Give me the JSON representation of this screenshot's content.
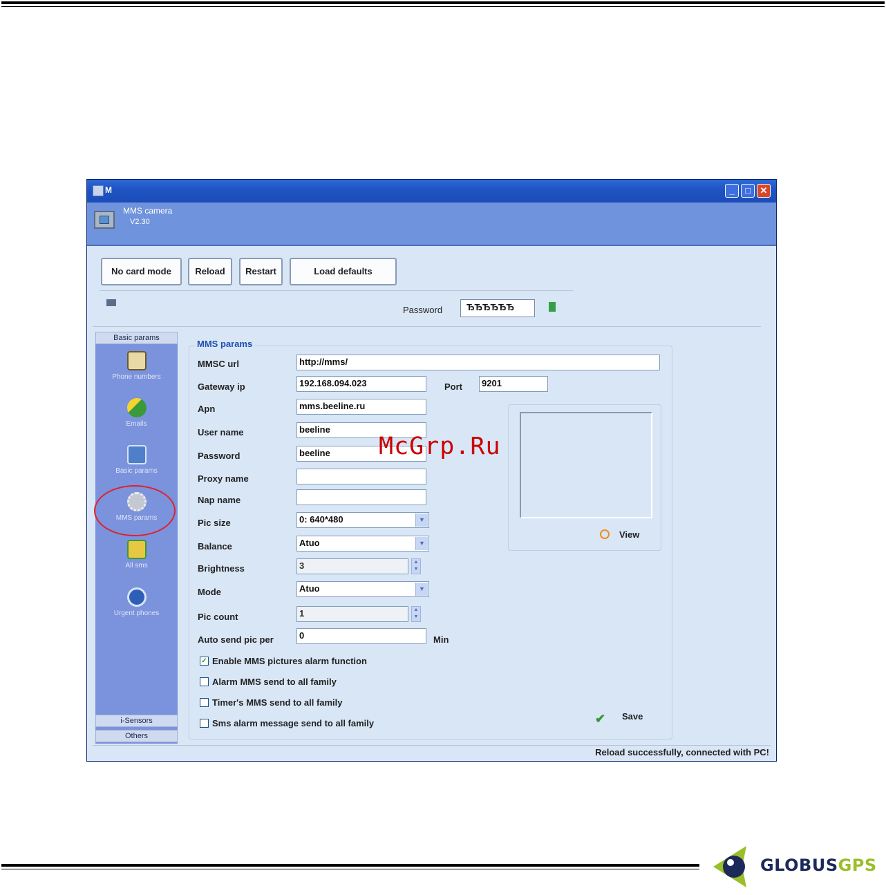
{
  "window": {
    "title": "M"
  },
  "header": {
    "app_name": "MMS camera",
    "version": "V2.30"
  },
  "toolbar": {
    "no_card_mode": "No card mode",
    "reload": "Reload",
    "restart": "Restart",
    "load_defaults": "Load defaults"
  },
  "password": {
    "label": "Password",
    "value": "ЂЂЂЂЂЂ"
  },
  "sidebar": {
    "top_header": "Basic params",
    "items": [
      {
        "label": "Phone numbers",
        "icon": "phone-book-icon"
      },
      {
        "label": "Emails",
        "icon": "email-icon"
      },
      {
        "label": "Basic params",
        "icon": "basic-params-icon"
      },
      {
        "label": "MMS params",
        "icon": "mms-params-icon"
      },
      {
        "label": "All sms",
        "icon": "sms-icon"
      },
      {
        "label": "Urgent phones",
        "icon": "urgent-phone-icon"
      }
    ],
    "bottom_headers": [
      "i-Sensors",
      "Others"
    ]
  },
  "panel": {
    "title": "MMS params",
    "mmsc_url": {
      "label": "MMSC url",
      "value": "http://mms/"
    },
    "gateway_ip": {
      "label": "Gateway ip",
      "value": "192.168.094.023"
    },
    "port": {
      "label": "Port",
      "value": "9201"
    },
    "apn": {
      "label": "Apn",
      "value": "mms.beeline.ru"
    },
    "user_name": {
      "label": "User name",
      "value": "beeline"
    },
    "password": {
      "label": "Password",
      "value": "beeline"
    },
    "proxy_name": {
      "label": "Proxy name",
      "value": ""
    },
    "nap_name": {
      "label": "Nap name",
      "value": ""
    },
    "pic_size": {
      "label": "Pic size",
      "value": "0: 640*480"
    },
    "balance": {
      "label": "Balance",
      "value": "Atuo"
    },
    "brightness": {
      "label": "Brightness",
      "value": "3"
    },
    "mode": {
      "label": "Mode",
      "value": "Atuo"
    },
    "pic_count": {
      "label": "Pic count",
      "value": "1"
    },
    "auto_send": {
      "label": "Auto send pic per",
      "value": "0",
      "unit": "Min"
    },
    "checkboxes": [
      {
        "label": "Enable MMS pictures alarm function",
        "checked": true
      },
      {
        "label": "Alarm MMS send to all family",
        "checked": false
      },
      {
        "label": "Timer's MMS send to all family",
        "checked": false
      },
      {
        "label": "Sms alarm message send to all family",
        "checked": false
      }
    ],
    "view_label": "View",
    "save_label": "Save"
  },
  "status": "Reload successfully, connected with PC!",
  "watermark": "McGrp.Ru",
  "logo": {
    "part1": "GLOBUS",
    "part2": "GPS"
  },
  "colors": {
    "accent": "#1d4fb0",
    "sidebar": "#7b92dc",
    "highlight": "#e0202a",
    "watermark": "#cc0000",
    "logo_dark": "#1c2a5a",
    "logo_green": "#9bbf2a"
  }
}
